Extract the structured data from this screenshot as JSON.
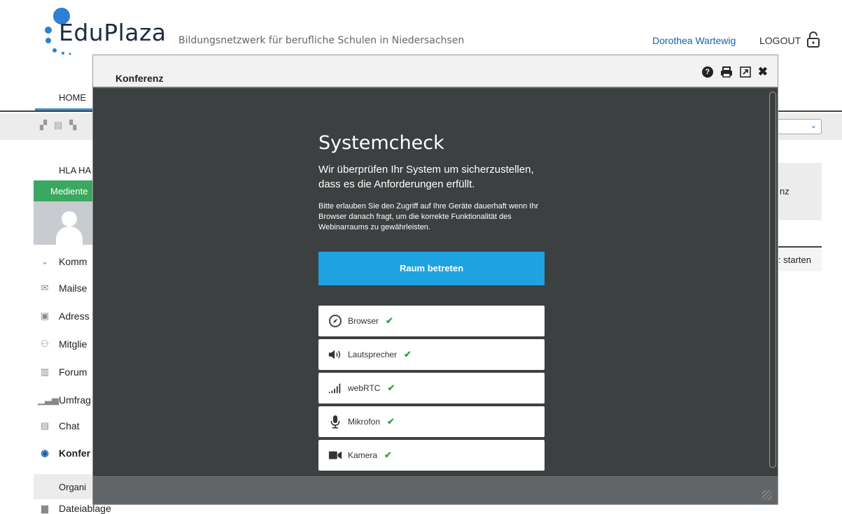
{
  "header": {
    "brand": "EduPlaza",
    "tagline": "Bildungsnetzwerk für berufliche Schulen in Niedersachsen",
    "user": "Dorothea Wartewig",
    "logout": "LOGOUT"
  },
  "nav": {
    "home": "HOME"
  },
  "background": {
    "group": "HLA HA",
    "green_label": "Mediente",
    "right_panel_text": "nz",
    "right_button": ": starten",
    "org_row": "Organi"
  },
  "sidebar": {
    "items": [
      {
        "label": "Komm",
        "icon": "chevron-down-icon"
      },
      {
        "label": "Mailse",
        "icon": "mail-icon"
      },
      {
        "label": "Adress",
        "icon": "addressbook-icon"
      },
      {
        "label": "Mitglie",
        "icon": "members-icon"
      },
      {
        "label": "Forum",
        "icon": "forum-icon"
      },
      {
        "label": "Umfrag",
        "icon": "poll-icon"
      },
      {
        "label": "Chat",
        "icon": "chat-icon"
      },
      {
        "label": "Konfer",
        "icon": "conference-icon"
      },
      {
        "label": "Dateiablage",
        "icon": "folder-icon"
      }
    ]
  },
  "modal": {
    "title": "Konferenz",
    "systemcheck": {
      "title": "Systemcheck",
      "subtitle": "Wir überprüfen Ihr System um sicherzustellen, dass es die Anforderungen erfüllt.",
      "note": "Bitte erlauben Sie den Zugriff auf Ihre Geräte dauerhaft wenn Ihr Browser danach fragt, um die korrekte Funktionalität des Webinarraums zu gewährleisten.",
      "enter_button": "Raum betreten",
      "checks": [
        {
          "label": "Browser",
          "icon": "compass-icon",
          "status": "ok"
        },
        {
          "label": "Lautsprecher",
          "icon": "speaker-icon",
          "status": "ok"
        },
        {
          "label": "webRTC",
          "icon": "signal-icon",
          "status": "ok"
        },
        {
          "label": "Mikrofon",
          "icon": "microphone-icon",
          "status": "ok"
        },
        {
          "label": "Kamera",
          "icon": "camera-icon",
          "status": "ok"
        }
      ]
    }
  },
  "colors": {
    "accent_blue": "#1ea3e0",
    "green": "#3aa860",
    "modal_bg": "#3d4041"
  }
}
